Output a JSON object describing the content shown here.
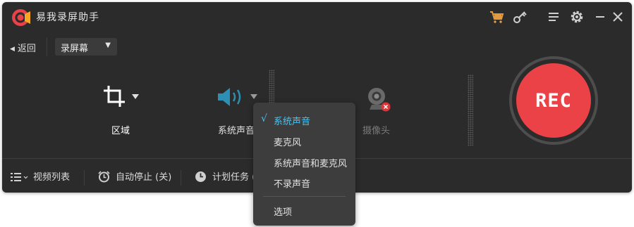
{
  "app": {
    "title": "易我录屏助手"
  },
  "titlebar": {
    "icons": [
      "cart-icon",
      "key-icon",
      "menu-icon",
      "settings-icon",
      "minimize-icon",
      "close-icon"
    ]
  },
  "toolbar": {
    "back_label": "返回",
    "mode_select": {
      "value": "录屏幕"
    }
  },
  "sources": {
    "region": {
      "label": "区域",
      "icon": "crop-icon"
    },
    "audio": {
      "label": "系统声音",
      "icon": "speaker-icon"
    },
    "camera": {
      "label": "摄像头",
      "icon": "webcam-icon",
      "status": "disabled"
    }
  },
  "rec_button": {
    "label": "REC"
  },
  "bottom": {
    "video_list": "视频列表",
    "auto_stop": "自动停止 (关)",
    "schedule": "计划任务 ("
  },
  "audio_menu": {
    "items": [
      {
        "label": "系统声音",
        "checked": true
      },
      {
        "label": "麦克风",
        "checked": false
      },
      {
        "label": "系统声音和麦克风",
        "checked": false
      },
      {
        "label": "不录声音",
        "checked": false
      }
    ],
    "options_label": "选项",
    "check_mark": "√"
  },
  "colors": {
    "accent_red": "#ea4246",
    "check_blue": "#4ac2ee",
    "window_bg": "#2b2b2b",
    "cart_orange": "#e39a3c"
  }
}
